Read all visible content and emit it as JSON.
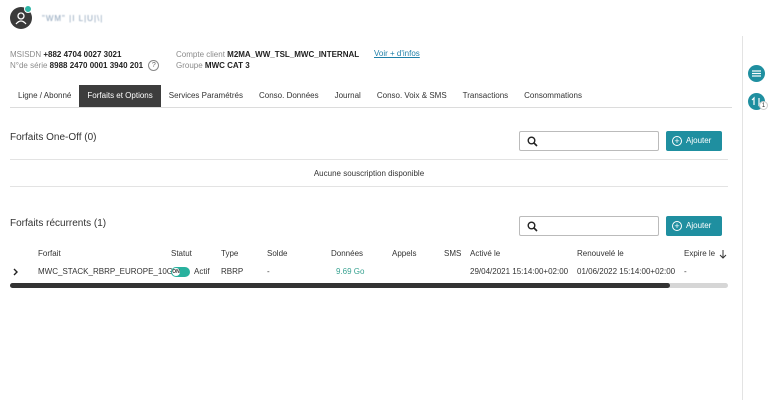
{
  "brand": {
    "name": "\"WM\" |I  L|U|\\|"
  },
  "line_info": {
    "msisdn_label": "MSISDN",
    "msisdn_value": "+882 4704 0027 3021",
    "serial_label": "N°de série",
    "serial_value": "8988 2470 0001 3940 201",
    "client_label": "Compte client",
    "client_value": "M2MA_WW_TSL_MWC_INTERNAL",
    "group_label": "Groupe",
    "group_value": "MWC CAT 3",
    "more_link": "Voir + d'infos",
    "help_symbol": "?"
  },
  "tabs": [
    {
      "label": "Ligne / Abonné",
      "active": false
    },
    {
      "label": "Forfaits et Options",
      "active": true
    },
    {
      "label": "Services Paramétrés",
      "active": false
    },
    {
      "label": "Conso. Données",
      "active": false
    },
    {
      "label": "Journal",
      "active": false
    },
    {
      "label": "Conso. Voix & SMS",
      "active": false
    },
    {
      "label": "Transactions",
      "active": false
    },
    {
      "label": "Consommations",
      "active": false
    }
  ],
  "one_off": {
    "title": "Forfaits One-Off (0)",
    "search_placeholder": "",
    "add_label": "Ajouter",
    "empty_message": "Aucune souscription disponible"
  },
  "recurring": {
    "title": "Forfaits récurrents (1)",
    "search_placeholder": "",
    "add_label": "Ajouter",
    "columns": [
      "Forfait",
      "Statut",
      "Type",
      "Solde",
      "Données",
      "Appels",
      "SMS",
      "Activé le",
      "Renouvelé le",
      "Expire le"
    ],
    "rows": [
      {
        "forfait": "MWC_STACK_RBRP_EUROPE_10GB",
        "toggle_text": "ON",
        "statut": "Actif",
        "type": "RBRP",
        "solde": "-",
        "donnees": "9.69 Go",
        "appels": "",
        "sms": "",
        "active_le": "29/04/2021 15:14:00+02:00",
        "renouvele_le": "01/06/2022 15:14:00+02:00",
        "expire_le": "-"
      }
    ]
  },
  "right_panel": {
    "badge_count": "1"
  },
  "colors": {
    "accent": "#1f8fa0",
    "active_tab": "#3d3d3d",
    "toggle_on": "#29b19e",
    "link": "#1e7fa8"
  }
}
